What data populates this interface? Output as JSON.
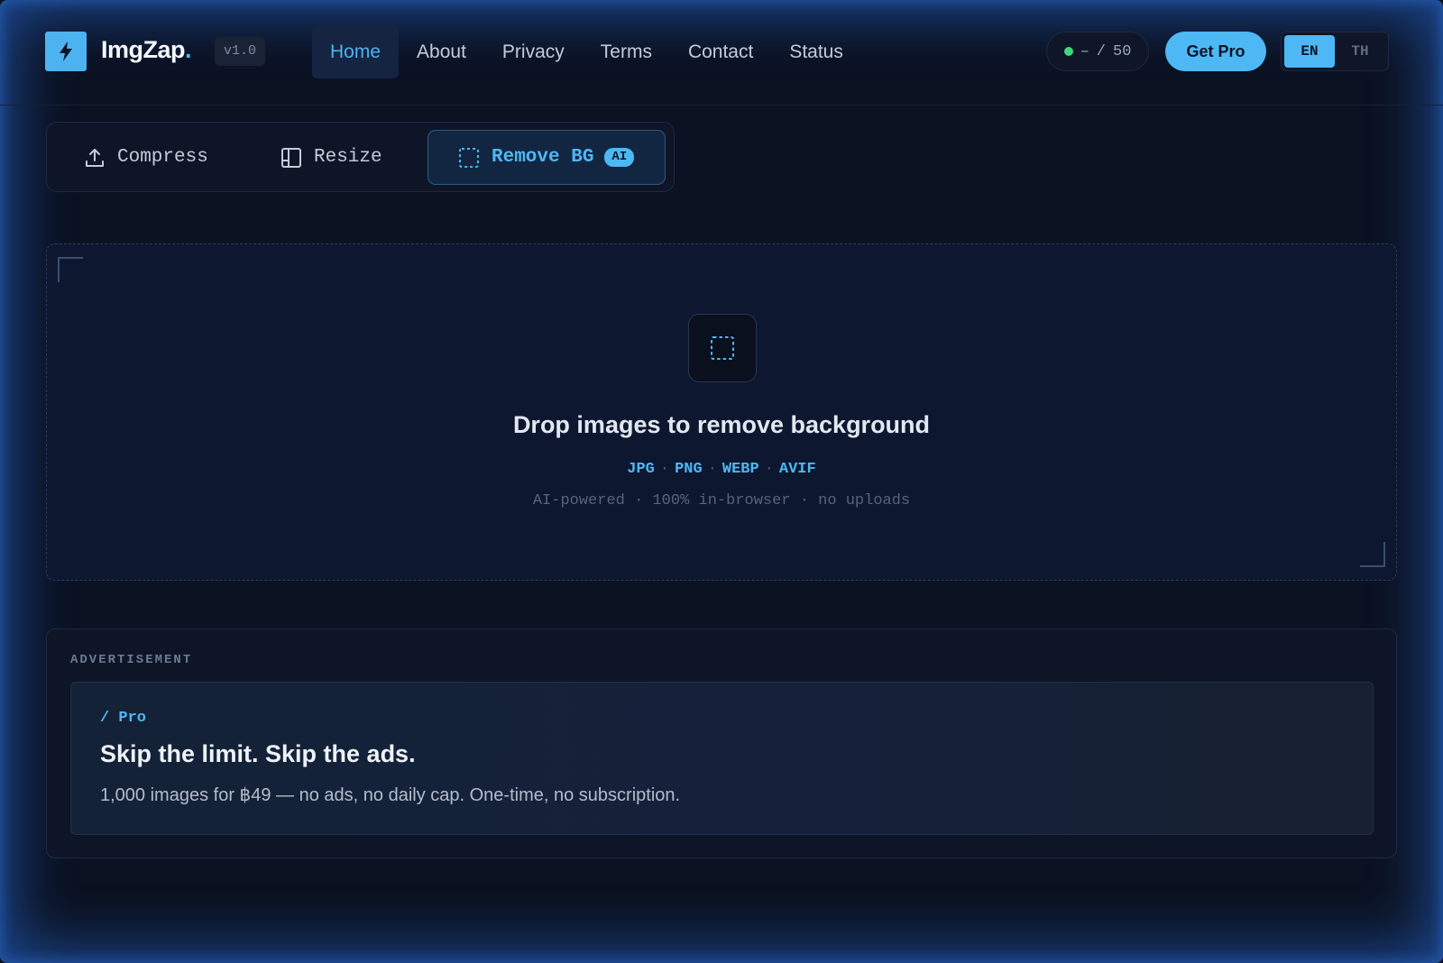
{
  "brand": {
    "name": "ImgZap",
    "dot": ".",
    "version": "v1.0",
    "accent": "#4db8f4"
  },
  "nav": {
    "items": [
      {
        "label": "Home",
        "active": true
      },
      {
        "label": "About",
        "active": false
      },
      {
        "label": "Privacy",
        "active": false
      },
      {
        "label": "Terms",
        "active": false
      },
      {
        "label": "Contact",
        "active": false
      },
      {
        "label": "Status",
        "active": false
      }
    ]
  },
  "usage": {
    "current": "–",
    "separator": "/",
    "limit": "50",
    "status_color": "#42d47a"
  },
  "cta": {
    "get_pro_label": "Get Pro"
  },
  "language": {
    "options": [
      "EN",
      "TH"
    ],
    "selected": "EN"
  },
  "tools": {
    "compress": {
      "label": "Compress",
      "icon": "upload-icon"
    },
    "resize": {
      "label": "Resize",
      "icon": "resize-frame-icon"
    },
    "remove_bg": {
      "label": "Remove BG",
      "badge": "AI",
      "icon": "selection-dashed-icon",
      "active": true
    }
  },
  "dropzone": {
    "icon": "selection-dashed-icon",
    "title": "Drop images to remove background",
    "formats": [
      "JPG",
      "PNG",
      "WEBP",
      "AVIF"
    ],
    "note": "AI-powered · 100% in-browser · no uploads"
  },
  "ad": {
    "label": "ADVERTISEMENT",
    "kicker": "/ Pro",
    "title": "Skip the limit. Skip the ads.",
    "body": "1,000 images for ฿49 — no ads, no daily cap. One-time, no subscription."
  }
}
